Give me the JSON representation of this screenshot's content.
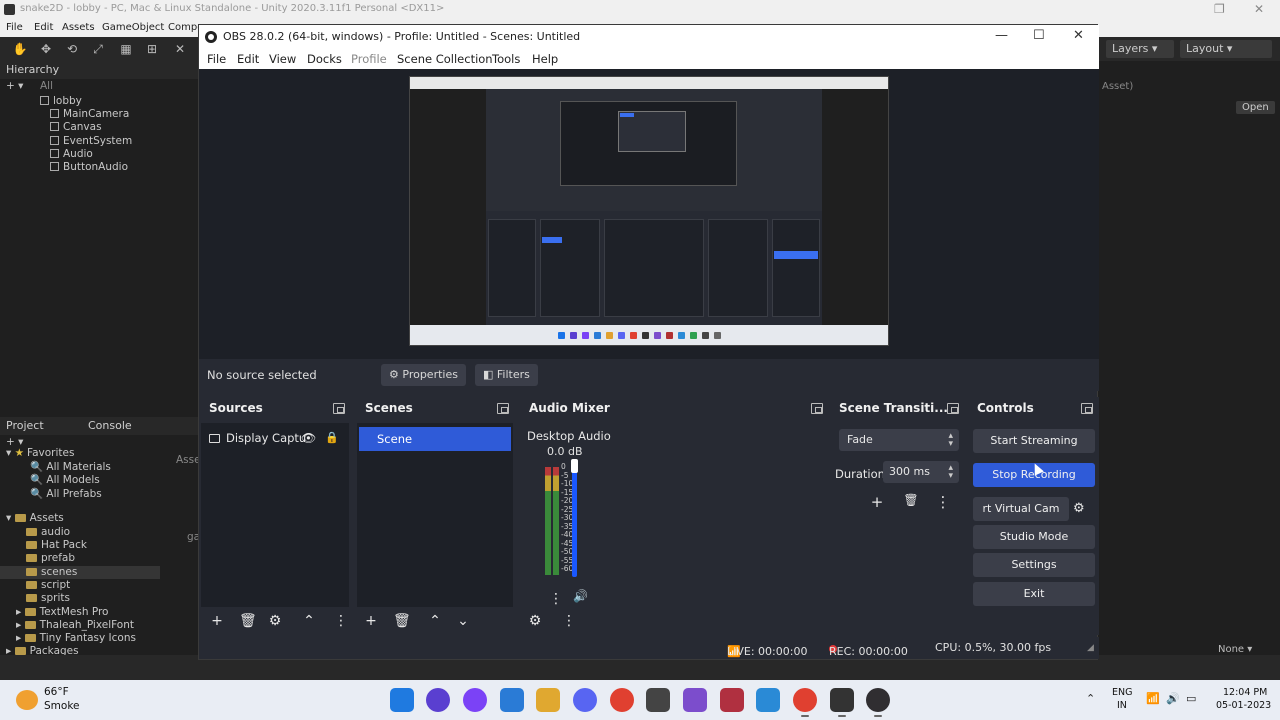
{
  "unity": {
    "title": "snake2D - lobby - PC, Mac & Linux Standalone - Unity 2020.3.11f1 Personal <DX11>",
    "menu": [
      "File",
      "Edit",
      "Assets",
      "GameObject",
      "Compo"
    ],
    "toolbar_right": {
      "layers": "Layers",
      "layout": "Layout"
    },
    "hierarchy": {
      "title": "Hierarchy",
      "search": "All",
      "scene": "lobby",
      "items": [
        "MainCamera",
        "Canvas",
        "EventSystem",
        "Audio",
        "ButtonAudio"
      ]
    },
    "project_tabs": [
      "Project",
      "Console"
    ],
    "favorites": {
      "label": "Favorites",
      "items": [
        "All Materials",
        "All Models",
        "All Prefabs"
      ]
    },
    "assets": {
      "label": "Assets",
      "items": [
        "audio",
        "Hat Pack",
        "prefab",
        "scenes",
        "script",
        "sprits",
        "TextMesh Pro",
        "Thaleah_PixelFont",
        "Tiny Fantasy Icons"
      ]
    },
    "packages": "Packages",
    "right_hint": "Asset)",
    "open": "Open",
    "none": "None",
    "asse_label": "Asse",
    "ga_label": "ga"
  },
  "obs": {
    "title": "OBS 28.0.2 (64-bit, windows) - Profile: Untitled - Scenes: Untitled",
    "menu": {
      "file": "File",
      "edit": "Edit",
      "view": "View",
      "docks": "Docks",
      "profile": "Profile",
      "scene_collection": "Scene Collection",
      "tools": "Tools",
      "help": "Help"
    },
    "source_bar": {
      "no_source": "No source selected",
      "properties": "Properties",
      "filters": "Filters"
    },
    "docks": {
      "sources": {
        "title": "Sources",
        "items": [
          {
            "name": "Display Captu"
          }
        ]
      },
      "scenes": {
        "title": "Scenes",
        "items": [
          {
            "name": "Scene",
            "selected": true
          }
        ]
      },
      "audio_mixer": {
        "title": "Audio Mixer",
        "channel": "Desktop Audio",
        "level": "0.0 dB",
        "scale": [
          "0",
          "-5",
          "-10",
          "-15",
          "-20",
          "-25",
          "-30",
          "-35",
          "-40",
          "-45",
          "-50",
          "-55",
          "-60"
        ]
      },
      "transitions": {
        "title": "Scene Transiti...",
        "transition": "Fade",
        "duration_label": "Duration",
        "duration_value": "300 ms"
      },
      "controls": {
        "title": "Controls",
        "start_streaming": "Start Streaming",
        "stop_recording": "Stop Recording",
        "virtual_cam": "rt Virtual Cam",
        "studio_mode": "Studio Mode",
        "settings": "Settings",
        "exit": "Exit"
      }
    },
    "status": {
      "live": "LIVE: 00:00:00",
      "rec": "REC: 00:00:00",
      "cpu": "CPU: 0.5%, 30.00 fps"
    }
  },
  "taskbar": {
    "weather_temp": "66°F",
    "weather_desc": "Smoke",
    "lang_top": "ENG",
    "lang_bottom": "IN",
    "time": "12:04 PM",
    "date": "05-01-2023"
  },
  "colors": {
    "obs_bg": "#272a33",
    "obs_panel": "#1d2027",
    "obs_accent": "#2f5bd8",
    "rec_red": "#e03a3a"
  }
}
